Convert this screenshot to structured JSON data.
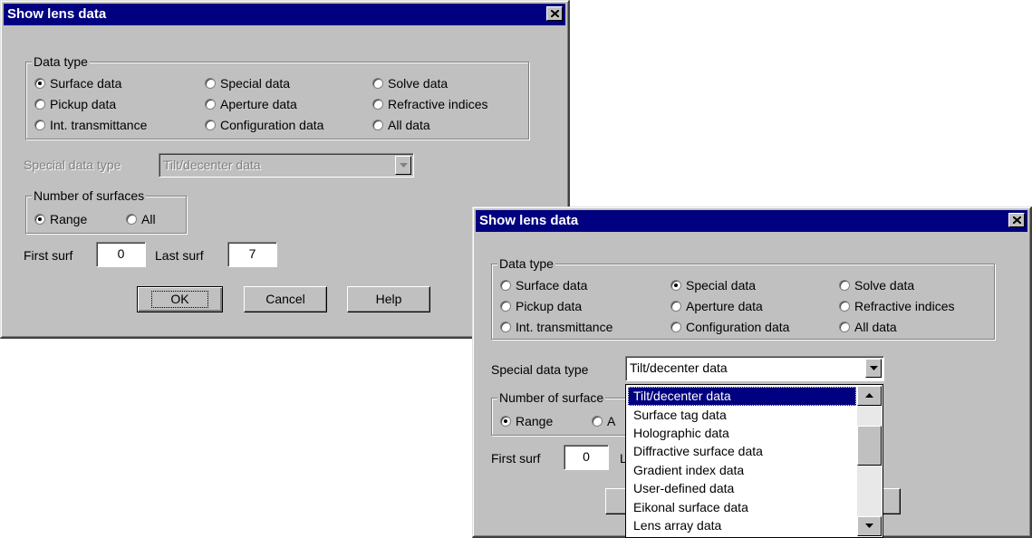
{
  "dialog1": {
    "title": "Show lens data",
    "data_type_label": "Data type",
    "radios": [
      {
        "label": "Surface data",
        "checked": true
      },
      {
        "label": "Special data",
        "checked": false
      },
      {
        "label": "Solve data",
        "checked": false
      },
      {
        "label": "Pickup data",
        "checked": false
      },
      {
        "label": "Aperture data",
        "checked": false
      },
      {
        "label": "Refractive indices",
        "checked": false
      },
      {
        "label": "Int. transmittance",
        "checked": false
      },
      {
        "label": "Configuration data",
        "checked": false
      },
      {
        "label": "All data",
        "checked": false
      }
    ],
    "special_label": "Special data type",
    "special_value": "Tilt/decenter data",
    "num_surfaces_label": "Number of surfaces",
    "range_label": "Range",
    "all_label": "All",
    "first_surf_label": "First surf",
    "first_surf_value": "0",
    "last_surf_label": "Last surf",
    "last_surf_value": "7",
    "ok_label": "OK",
    "cancel_label": "Cancel",
    "help_label": "Help"
  },
  "dialog2": {
    "title": "Show lens data",
    "data_type_label": "Data type",
    "radios": [
      {
        "label": "Surface data",
        "checked": false
      },
      {
        "label": "Special data",
        "checked": true
      },
      {
        "label": "Solve data",
        "checked": false
      },
      {
        "label": "Pickup data",
        "checked": false
      },
      {
        "label": "Aperture data",
        "checked": false
      },
      {
        "label": "Refractive indices",
        "checked": false
      },
      {
        "label": "Int. transmittance",
        "checked": false
      },
      {
        "label": "Configuration data",
        "checked": false
      },
      {
        "label": "All data",
        "checked": false
      }
    ],
    "special_label": "Special data type",
    "special_value": "Tilt/decenter data",
    "num_surfaces_label": "Number of surface",
    "range_label": "Range",
    "all_label": "A",
    "first_surf_label": "First surf",
    "first_surf_value": "0",
    "last_surf_label_partial": "L",
    "dropdown_options": [
      "Tilt/decenter data",
      "Surface tag data",
      "Holographic data",
      "Diffractive surface data",
      "Gradient index data",
      "User-defined data",
      "Eikonal surface data",
      "Lens array data"
    ],
    "selected_option": "Tilt/decenter data"
  },
  "icons": {
    "close": "close-icon",
    "dropdown": "chevron-down-icon",
    "scroll_up": "arrow-up-icon",
    "scroll_down": "arrow-down-icon"
  },
  "colors": {
    "face": "#c0c0c0",
    "titlebar": "#000080",
    "selection": "#000080"
  }
}
